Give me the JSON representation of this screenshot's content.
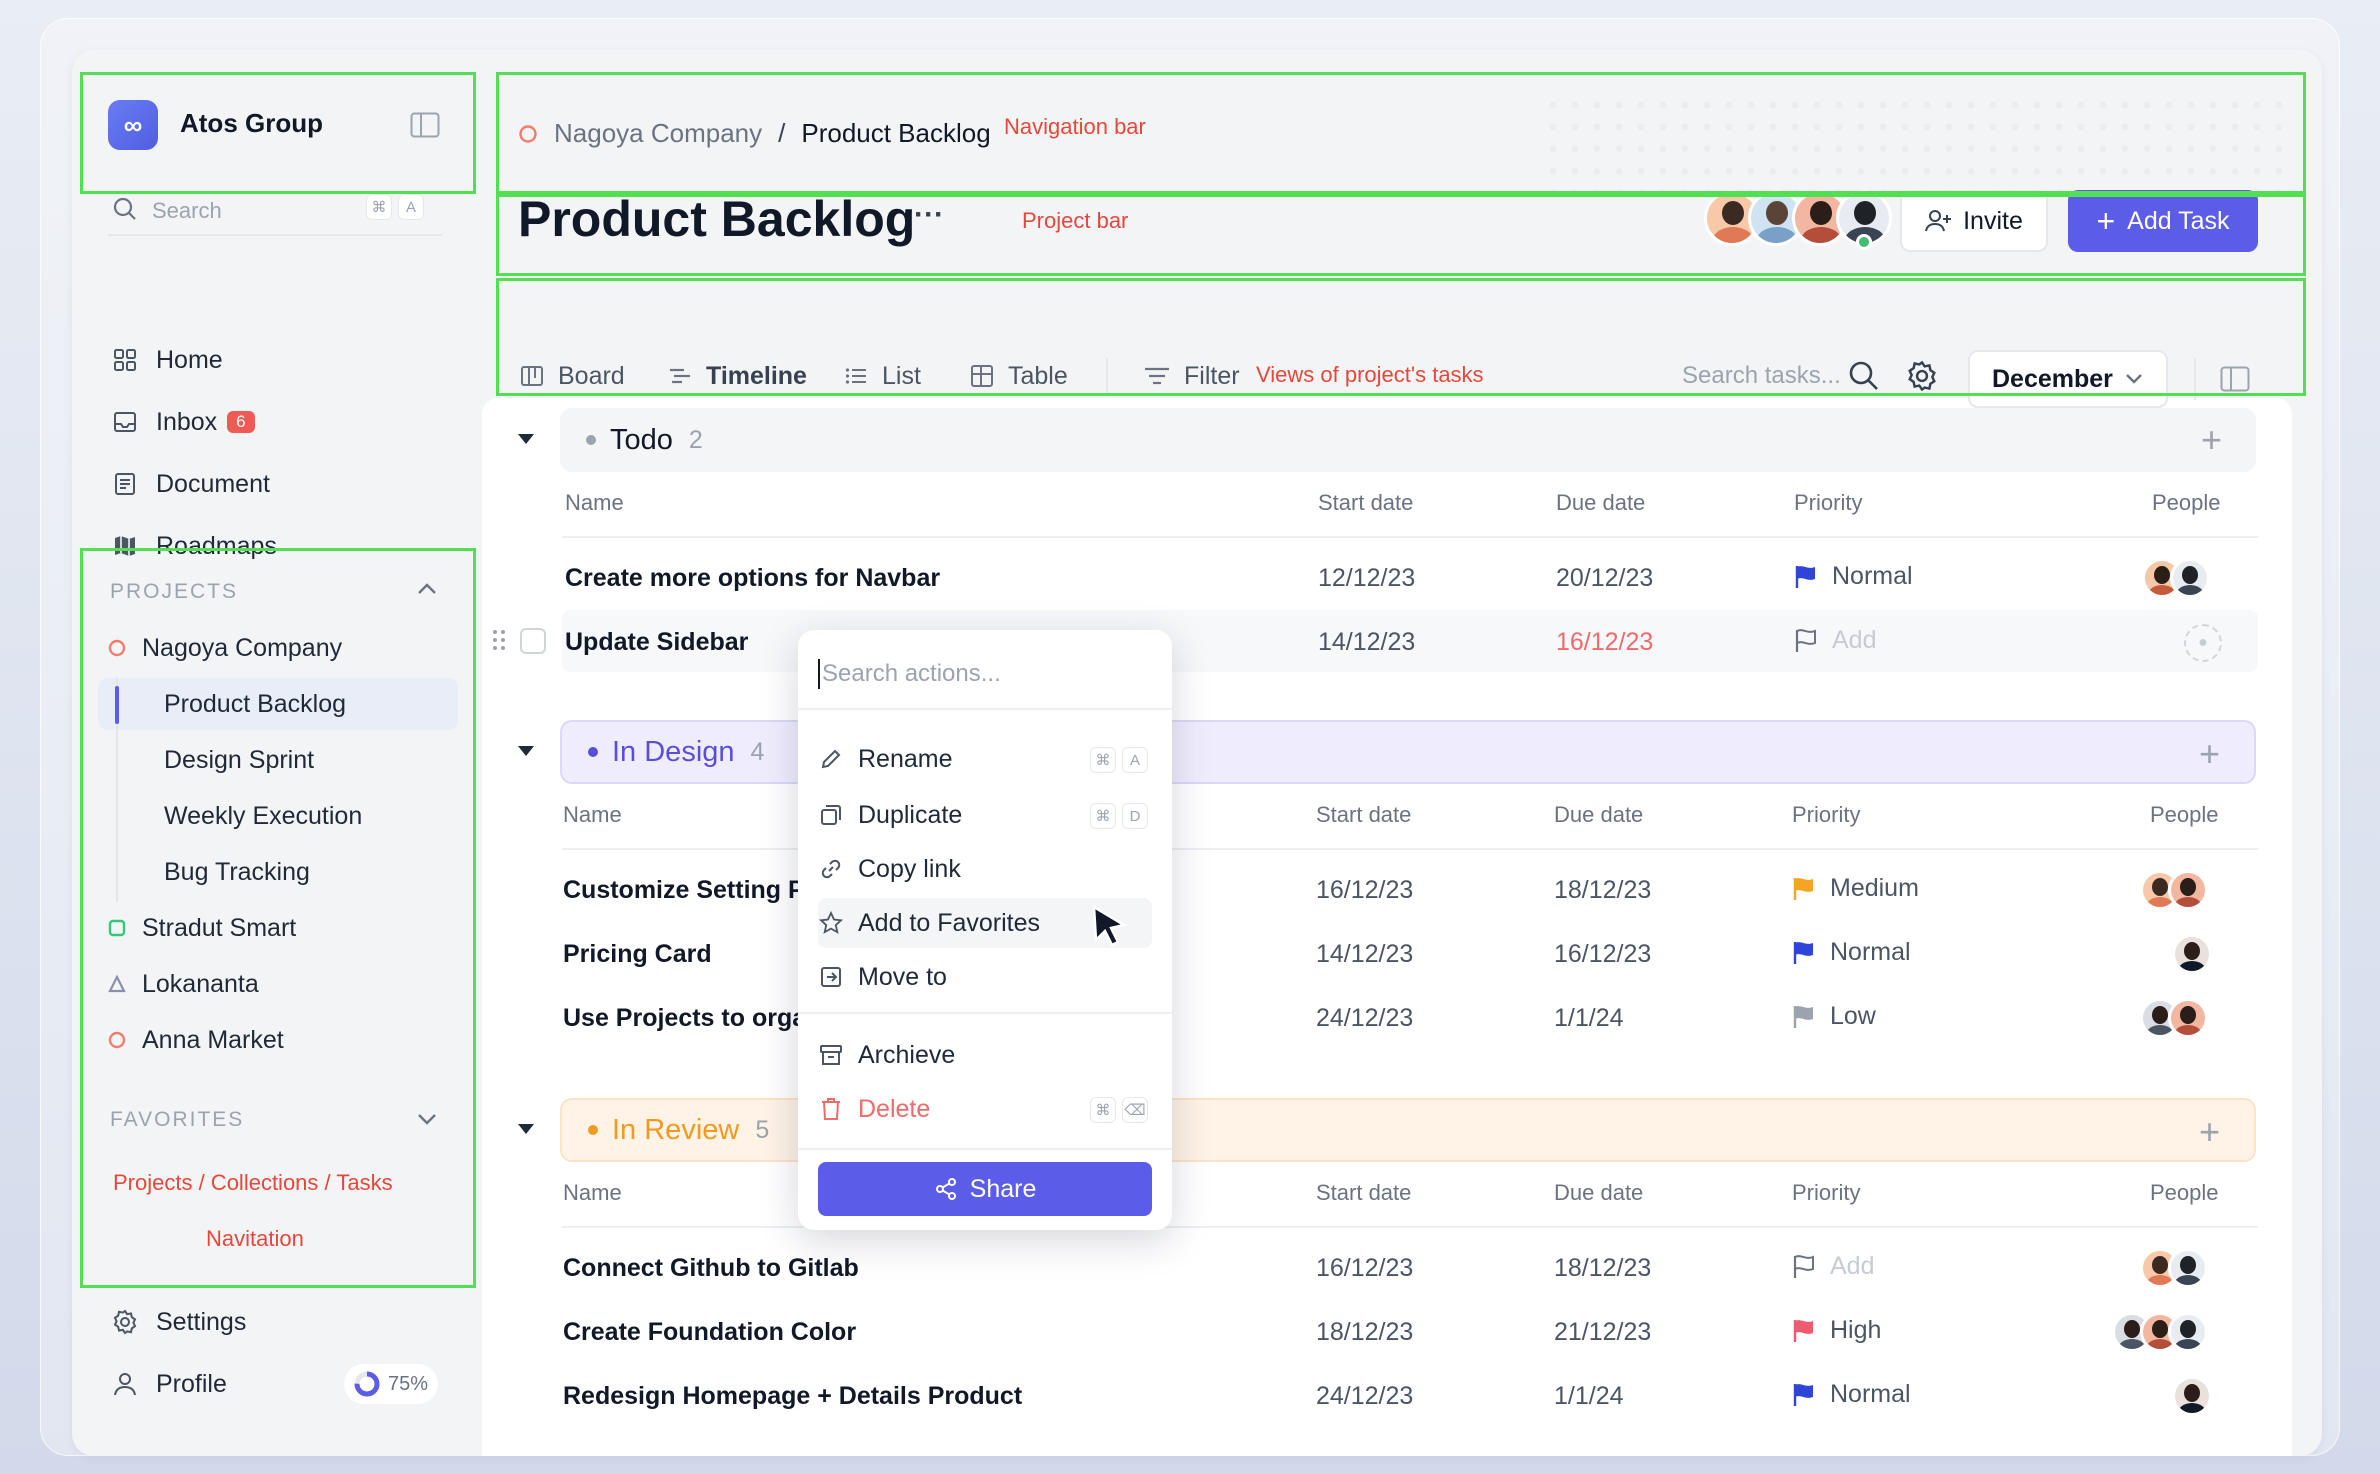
{
  "workspace": {
    "name": "Atos Group"
  },
  "sidebar": {
    "search_placeholder": "Search",
    "search_keys": [
      "⌘",
      "A"
    ],
    "nav": [
      {
        "label": "Home",
        "icon": "grid-icon"
      },
      {
        "label": "Inbox",
        "icon": "inbox-icon",
        "badge": "6"
      },
      {
        "label": "Document",
        "icon": "document-icon"
      },
      {
        "label": "Roadmaps",
        "icon": "map-icon"
      }
    ],
    "projects_header": "PROJECTS",
    "projects": [
      {
        "label": "Nagoya Company",
        "marker": "circle",
        "color": "#f47b6b"
      },
      {
        "label": "Stradut Smart",
        "marker": "square",
        "color": "#34c77b"
      },
      {
        "label": "Lokananta",
        "marker": "triangle",
        "color": "#8b8fa8"
      },
      {
        "label": "Anna Market",
        "marker": "circle",
        "color": "#f47b6b"
      }
    ],
    "sub_projects": [
      "Product Backlog",
      "Design Sprint",
      "Weekly Execution",
      "Bug Tracking"
    ],
    "favorites_header": "FAVORITES",
    "favorites_note": "Projects / Collections / Tasks",
    "nav_note": "Navitation",
    "settings_label": "Settings",
    "profile_label": "Profile",
    "profile_progress": "75%"
  },
  "breadcrumb": {
    "parent": "Nagoya Company",
    "sep": "/",
    "current": "Product Backlog"
  },
  "annotations": {
    "nav_bar": "Navigation bar",
    "project_bar": "Project bar",
    "views": "Views of project's tasks"
  },
  "project": {
    "title": "Product Backlog",
    "more": "···",
    "invite_label": "Invite",
    "add_task_label": "Add Task"
  },
  "views": {
    "tabs": [
      "Board",
      "Timeline",
      "List",
      "Table"
    ],
    "active": "List",
    "filter_label": "Filter",
    "search_placeholder": "Search tasks...",
    "month": "December"
  },
  "columns": {
    "name": "Name",
    "start": "Start date",
    "due": "Due date",
    "priority": "Priority",
    "people": "People"
  },
  "groups": [
    {
      "title": "Todo",
      "count": "2",
      "color": "#111827",
      "tasks": [
        {
          "name": "Create more options for Navbar",
          "start": "12/12/23",
          "due": "20/12/23",
          "priority": "Normal"
        },
        {
          "name": "Update Sidebar",
          "start": "14/12/23",
          "due": "16/12/23",
          "priority": "Add"
        }
      ]
    },
    {
      "title": "In Design",
      "count": "4",
      "color": "#5b4ed6",
      "tasks": [
        {
          "name": "Customize Setting Pa",
          "start": "16/12/23",
          "due": "18/12/23",
          "priority": "Medium"
        },
        {
          "name": "Pricing Card",
          "start": "14/12/23",
          "due": "16/12/23",
          "priority": "Normal"
        },
        {
          "name": "Use Projects to orgar",
          "start": "24/12/23",
          "due": "1/1/24",
          "priority": "Low"
        }
      ]
    },
    {
      "title": "In Review",
      "count": "5",
      "color": "#f29a1f",
      "tasks": [
        {
          "name": "Connect Github to Gitlab",
          "start": "16/12/23",
          "due": "18/12/23",
          "priority": "Add"
        },
        {
          "name": "Create Foundation Color",
          "start": "18/12/23",
          "due": "21/12/23",
          "priority": "High"
        },
        {
          "name": "Redesign Homepage + Details Product",
          "start": "24/12/23",
          "due": "1/1/24",
          "priority": "Normal"
        }
      ]
    }
  ],
  "context_menu": {
    "search_placeholder": "Search actions...",
    "items": [
      {
        "label": "Rename",
        "icon": "pencil-icon",
        "keys": [
          "⌘",
          "A"
        ]
      },
      {
        "label": "Duplicate",
        "icon": "duplicate-icon",
        "keys": [
          "⌘",
          "D"
        ]
      },
      {
        "label": "Copy link",
        "icon": "link-icon"
      },
      {
        "label": "Add to Favorites",
        "icon": "star-icon"
      },
      {
        "label": "Move to",
        "icon": "move-icon"
      },
      {
        "label": "Archieve",
        "icon": "archive-icon"
      },
      {
        "label": "Delete",
        "icon": "trash-icon",
        "keys": [
          "⌘",
          "⌫"
        ]
      }
    ],
    "share_label": "Share"
  },
  "colors": {
    "accent": "#5b5ce8",
    "danger": "#e5483b",
    "flag_blue": "#2f45d8",
    "flag_orange": "#f5a524",
    "flag_red": "#ef5b6e",
    "flag_gray": "#9ca3af"
  }
}
